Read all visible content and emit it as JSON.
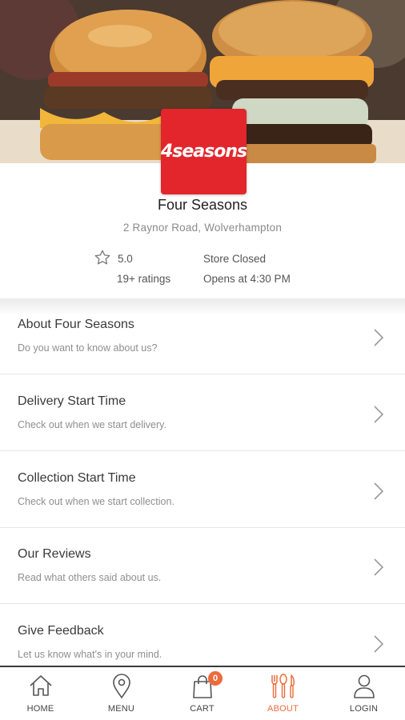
{
  "store": {
    "logo_text": "4seasons",
    "name": "Four Seasons",
    "address": "2 Raynor Road, Wolverhampton",
    "rating": "5.0",
    "ratings_count": "19+ ratings",
    "status": "Store Closed",
    "opens": "Opens at 4:30 PM"
  },
  "menu": {
    "items": [
      {
        "title": "About Four Seasons",
        "subtitle": "Do you want to know about us?"
      },
      {
        "title": "Delivery Start Time",
        "subtitle": "Check out when we start delivery."
      },
      {
        "title": "Collection Start Time",
        "subtitle": "Check out when we start collection."
      },
      {
        "title": "Our Reviews",
        "subtitle": "Read what others said about us."
      },
      {
        "title": "Give Feedback",
        "subtitle": "Let us know what's in your mind."
      }
    ]
  },
  "nav": {
    "items": [
      {
        "label": "HOME",
        "icon": "home-icon"
      },
      {
        "label": "MENU",
        "icon": "location-pin-icon"
      },
      {
        "label": "CART",
        "icon": "shopping-bag-icon"
      },
      {
        "label": "ABOUT",
        "icon": "cutlery-icon"
      },
      {
        "label": "LOGIN",
        "icon": "user-icon"
      }
    ],
    "cart_count": "0",
    "active": "ABOUT"
  },
  "colors": {
    "accent": "#ec6b3c",
    "logo_red": "#e3262c"
  }
}
